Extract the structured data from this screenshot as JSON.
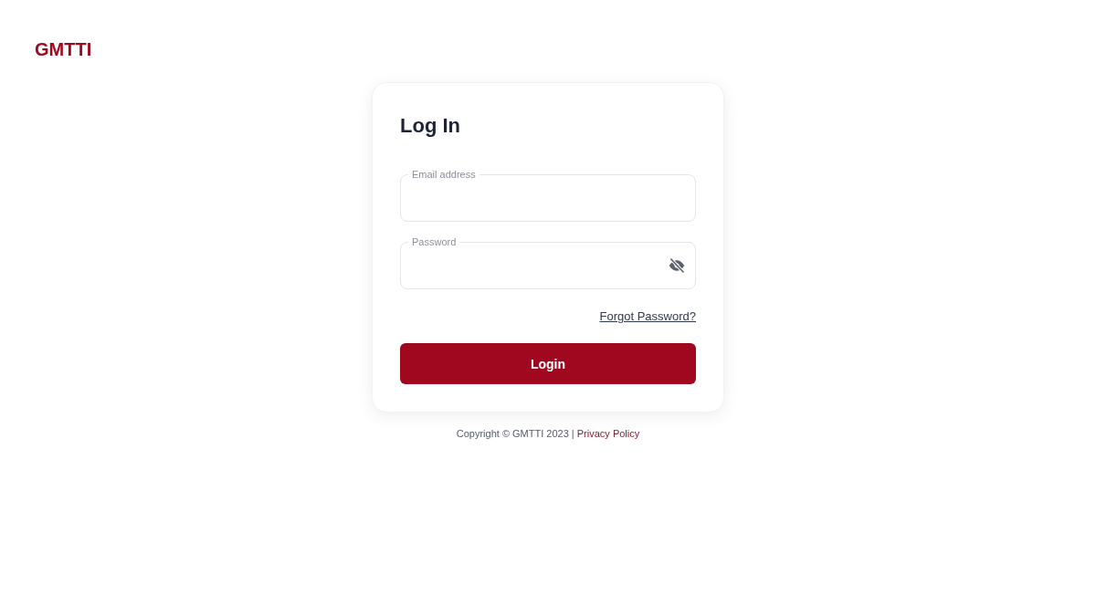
{
  "logo": "GMTTI",
  "card": {
    "title": "Log In",
    "fields": [
      {
        "label": "Email address",
        "kind": "text"
      },
      {
        "label": "Password",
        "kind": "password"
      }
    ],
    "forgot_link": "Forgot Password?",
    "submit": "Login"
  },
  "footer": {
    "copyright": "Copyright © GMTTI 2023 |",
    "link": "Privacy Policy"
  }
}
